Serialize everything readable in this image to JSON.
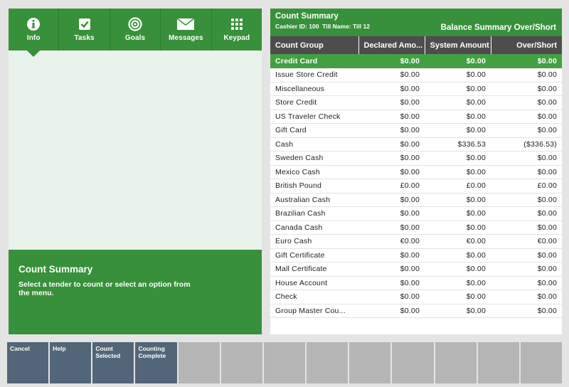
{
  "nav": {
    "items": [
      {
        "label": "Info",
        "icon": "info-icon",
        "active": true
      },
      {
        "label": "Tasks",
        "icon": "checkbox-icon",
        "active": false
      },
      {
        "label": "Goals",
        "icon": "target-icon",
        "active": false
      },
      {
        "label": "Messages",
        "icon": "envelope-icon",
        "active": false
      },
      {
        "label": "Keypad",
        "icon": "keypad-icon",
        "active": false
      }
    ]
  },
  "info": {
    "title": "Count Summary",
    "text": "Select a tender to count or select an option from the menu."
  },
  "summary": {
    "title": "Count Summary",
    "cashier_label": "Cashier ID:",
    "cashier_id": "100",
    "till_label": "Till Name:",
    "till_name": "Till 12",
    "right_title": "Balance Summary Over/Short",
    "columns": [
      "Count Group",
      "Declared Amo...",
      "System Amount",
      "Over/Short"
    ],
    "rows": [
      {
        "group": "Credit Card",
        "declared": "$0.00",
        "system": "$0.00",
        "over_short": "$0.00",
        "selected": true
      },
      {
        "group": "Issue Store Credit",
        "declared": "$0.00",
        "system": "$0.00",
        "over_short": "$0.00"
      },
      {
        "group": "Miscellaneous",
        "declared": "$0.00",
        "system": "$0.00",
        "over_short": "$0.00"
      },
      {
        "group": "Store Credit",
        "declared": "$0.00",
        "system": "$0.00",
        "over_short": "$0.00"
      },
      {
        "group": "US Traveler Check",
        "declared": "$0.00",
        "system": "$0.00",
        "over_short": "$0.00"
      },
      {
        "group": "Gift Card",
        "declared": "$0.00",
        "system": "$0.00",
        "over_short": "$0.00"
      },
      {
        "group": "Cash",
        "declared": "$0.00",
        "system": "$336.53",
        "over_short": "($336.53)"
      },
      {
        "group": "Sweden Cash",
        "declared": "$0.00",
        "system": "$0.00",
        "over_short": "$0.00"
      },
      {
        "group": "Mexico Cash",
        "declared": "$0.00",
        "system": "$0.00",
        "over_short": "$0.00"
      },
      {
        "group": "British Pound",
        "declared": "£0.00",
        "system": "£0.00",
        "over_short": "£0.00"
      },
      {
        "group": "Australian Cash",
        "declared": "$0.00",
        "system": "$0.00",
        "over_short": "$0.00"
      },
      {
        "group": "Brazilian Cash",
        "declared": "$0.00",
        "system": "$0.00",
        "over_short": "$0.00"
      },
      {
        "group": "Canada Cash",
        "declared": "$0.00",
        "system": "$0.00",
        "over_short": "$0.00"
      },
      {
        "group": "Euro Cash",
        "declared": "€0.00",
        "system": "€0.00",
        "over_short": "€0.00"
      },
      {
        "group": "Gift Certificate",
        "declared": "$0.00",
        "system": "$0.00",
        "over_short": "$0.00"
      },
      {
        "group": "Mall Certificate",
        "declared": "$0.00",
        "system": "$0.00",
        "over_short": "$0.00"
      },
      {
        "group": "House Account",
        "declared": "$0.00",
        "system": "$0.00",
        "over_short": "$0.00"
      },
      {
        "group": "Check",
        "declared": "$0.00",
        "system": "$0.00",
        "over_short": "$0.00"
      },
      {
        "group": "Group Master Cou...",
        "declared": "$0.00",
        "system": "$0.00",
        "over_short": "$0.00"
      }
    ]
  },
  "buttons": [
    {
      "label": "Cancel",
      "active": true
    },
    {
      "label": "Help",
      "active": true
    },
    {
      "label": "Count Selected",
      "active": true
    },
    {
      "label": "Counting Complete",
      "active": true
    },
    {
      "label": "",
      "active": false
    },
    {
      "label": "",
      "active": false
    },
    {
      "label": "",
      "active": false
    },
    {
      "label": "",
      "active": false
    },
    {
      "label": "",
      "active": false
    },
    {
      "label": "",
      "active": false
    },
    {
      "label": "",
      "active": false
    },
    {
      "label": "",
      "active": false
    },
    {
      "label": "",
      "active": false
    }
  ]
}
